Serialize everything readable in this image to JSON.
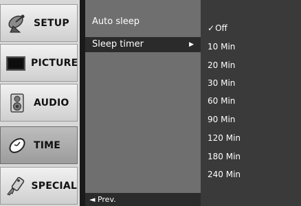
{
  "sidebar": {
    "items": [
      {
        "label": "SETUP",
        "icon": "satellite-dish-icon"
      },
      {
        "label": "PICTURE",
        "icon": "tv-screen-icon"
      },
      {
        "label": "AUDIO",
        "icon": "speaker-icon"
      },
      {
        "label": "TIME",
        "icon": "clock-icon",
        "active": true
      },
      {
        "label": "SPECIAL",
        "icon": "key-tag-icon"
      }
    ]
  },
  "submenu": {
    "items": [
      {
        "label": "Auto sleep"
      },
      {
        "label": "Sleep timer",
        "selected": true,
        "arrow": "▶"
      }
    ],
    "footer": "◄ Prev."
  },
  "options": {
    "check_mark": "✓",
    "items": [
      "Off",
      "10 Min",
      "20 Min",
      "30 Min",
      "60 Min",
      "90 Min",
      "120 Min",
      "180 Min",
      "240 Min"
    ],
    "checked_index": 0
  }
}
